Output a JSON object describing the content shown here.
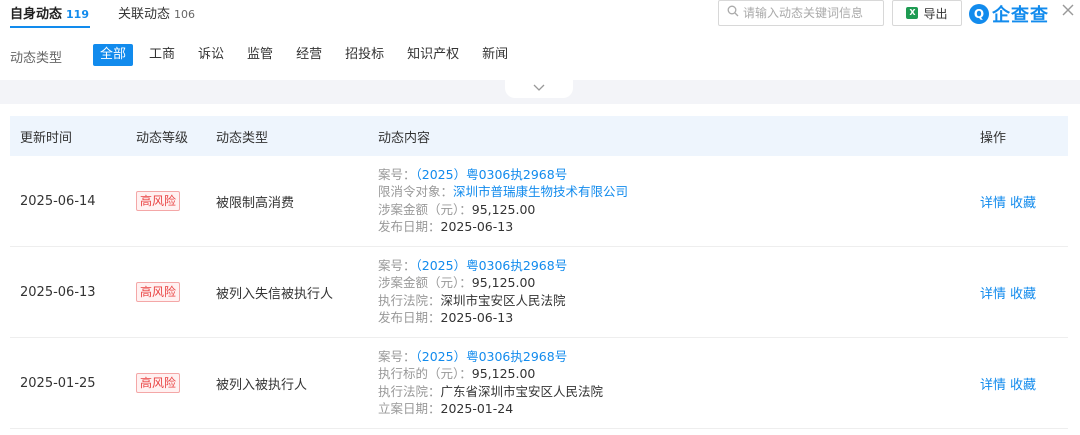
{
  "header": {
    "tab_active_label": "自身动态",
    "tab_active_count": "119",
    "tab_other_label": "关联动态",
    "tab_other_count": "106",
    "search_placeholder": "请输入动态关键词信息",
    "export_label": "导出",
    "logo_text": "企查查"
  },
  "filters": {
    "label": "动态类型",
    "items": [
      "全部",
      "工商",
      "诉讼",
      "监管",
      "经营",
      "招投标",
      "知识产权",
      "新闻"
    ],
    "active_index": 0
  },
  "table": {
    "headers": [
      "更新时间",
      "动态等级",
      "动态类型",
      "动态内容",
      "操作"
    ],
    "rows": [
      {
        "date": "2025-06-14",
        "level": "高风险",
        "type": "被限制高消费",
        "content": [
          {
            "k": "案号：",
            "v": "（2025）粤0306执2968号",
            "link": true
          },
          {
            "k": "限消令对象：",
            "v": "深圳市普瑞康生物技术有限公司",
            "link": true
          },
          {
            "k": "涉案金额（元）：",
            "v": "95,125.00",
            "link": false
          },
          {
            "k": "发布日期：",
            "v": "2025-06-13",
            "link": false
          }
        ],
        "ops": [
          "详情",
          "收藏"
        ]
      },
      {
        "date": "2025-06-13",
        "level": "高风险",
        "type": "被列入失信被执行人",
        "content": [
          {
            "k": "案号：",
            "v": "（2025）粤0306执2968号",
            "link": true
          },
          {
            "k": "涉案金额（元）：",
            "v": "95,125.00",
            "link": false
          },
          {
            "k": "执行法院：",
            "v": "深圳市宝安区人民法院",
            "link": false
          },
          {
            "k": "发布日期：",
            "v": "2025-06-13",
            "link": false
          }
        ],
        "ops": [
          "详情",
          "收藏"
        ]
      },
      {
        "date": "2025-01-25",
        "level": "高风险",
        "type": "被列入被执行人",
        "content": [
          {
            "k": "案号：",
            "v": "（2025）粤0306执2968号",
            "link": true
          },
          {
            "k": "执行标的（元）：",
            "v": "95,125.00",
            "link": false
          },
          {
            "k": "执行法院：",
            "v": "广东省深圳市宝安区人民法院",
            "link": false
          },
          {
            "k": "立案日期：",
            "v": "2025-01-24",
            "link": false
          }
        ],
        "ops": [
          "详情",
          "收藏"
        ]
      }
    ]
  },
  "colors": {
    "accent": "#128bed",
    "risk": "#e94141",
    "header_bg": "#eef5fd"
  },
  "icons": [
    "search-icon",
    "excel-icon",
    "logo-icon",
    "close-icon",
    "chevron-down-icon"
  ]
}
